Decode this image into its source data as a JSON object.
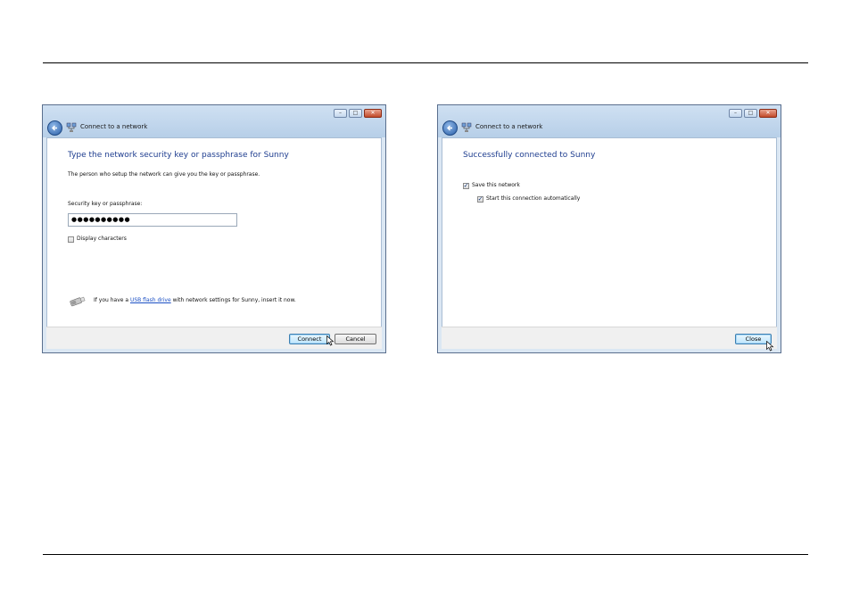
{
  "window1": {
    "title": "Connect to a network",
    "heading": "Type the network security key or passphrase for Sunny",
    "description": "The person who setup the network can give you the key or passphrase.",
    "key_label": "Security key or passphrase:",
    "key_value": "●●●●●●●●●●",
    "display_characters_label": "Display characters",
    "display_characters_checked": false,
    "usb_text_before": "If you have a",
    "usb_link": "USB flash drive",
    "usb_text_after": "with network settings for Sunny, insert it now.",
    "connect_label": "Connect",
    "cancel_label": "Cancel"
  },
  "window2": {
    "title": "Connect to a network",
    "heading": "Successfully connected to Sunny",
    "save_network_label": "Save this network",
    "save_network_checked": true,
    "start_auto_label": "Start this connection automatically",
    "start_auto_checked": true,
    "close_label": "Close"
  },
  "window_controls": {
    "minimize": "–",
    "maximize": "□",
    "close": "✕"
  },
  "icons": {
    "back": "back-arrow-icon",
    "network": "network-icon",
    "usb": "usb-drive-icon",
    "check": "✓"
  },
  "colors": {
    "heading": "#1e3d8f",
    "link": "#1a4fc4",
    "titlebar": "#b7cfe8",
    "close_button": "#c24a2a"
  }
}
